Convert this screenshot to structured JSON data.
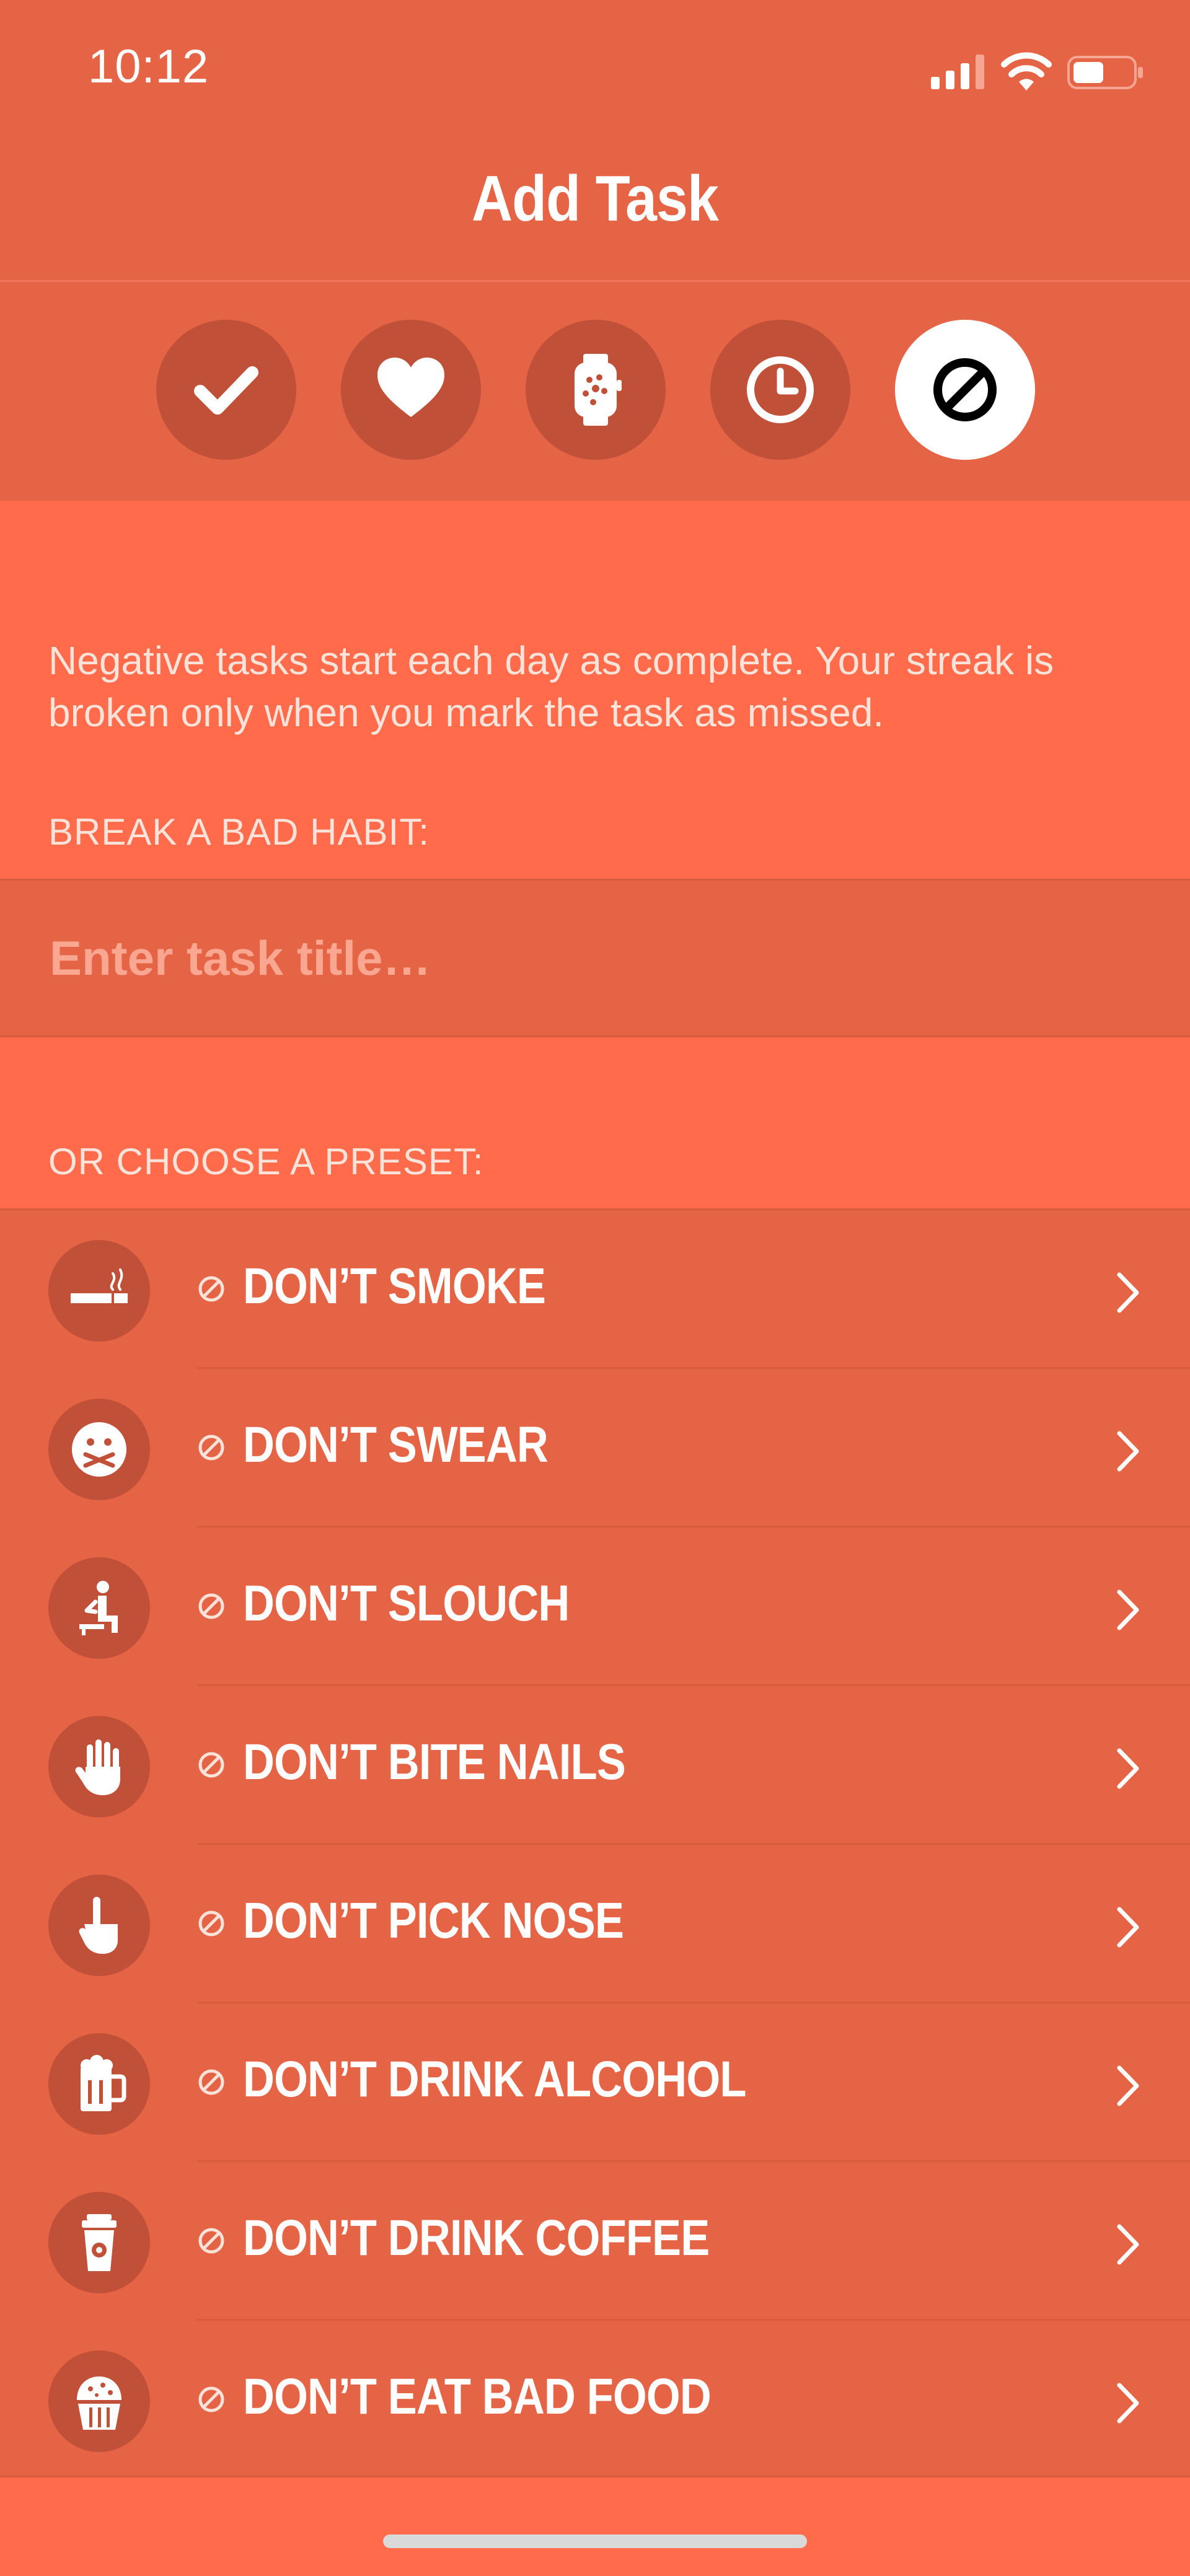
{
  "status_bar": {
    "time": "10:12",
    "icons": [
      "cellular-signal-icon",
      "wifi-icon",
      "battery-icon"
    ]
  },
  "nav": {
    "title": "Add Task"
  },
  "task_types": [
    {
      "icon": "checkmark-icon",
      "active": false
    },
    {
      "icon": "heart-icon",
      "active": false
    },
    {
      "icon": "watch-icon",
      "active": false
    },
    {
      "icon": "clock-icon",
      "active": false
    },
    {
      "icon": "ban-icon",
      "active": true
    }
  ],
  "description": "Negative tasks start each day as complete. Your streak is broken only when you mark the task as missed.",
  "break_label": "BREAK A BAD HABIT:",
  "task_input": {
    "value": "",
    "placeholder": "Enter task title…"
  },
  "preset_label": "OR CHOOSE A PRESET:",
  "presets": [
    {
      "label": "DON’T SMOKE",
      "icon": "cigarette-icon"
    },
    {
      "label": "DON’T SWEAR",
      "icon": "censored-face-icon"
    },
    {
      "label": "DON’T SLOUCH",
      "icon": "sitting-person-icon"
    },
    {
      "label": "DON’T BITE NAILS",
      "icon": "raised-hand-icon"
    },
    {
      "label": "DON’T PICK NOSE",
      "icon": "pointing-hand-icon"
    },
    {
      "label": "DON’T DRINK ALCOHOL",
      "icon": "beer-mug-icon"
    },
    {
      "label": "DON’T DRINK COFFEE",
      "icon": "coffee-cup-icon"
    },
    {
      "label": "DON’T EAT BAD FOOD",
      "icon": "cupcake-icon"
    }
  ],
  "colors": {
    "background": "#FF6B4B",
    "header": "#E66446",
    "circle": "#C05038",
    "active_circle": "#FFFFFF",
    "placeholder": "#F9A791"
  }
}
